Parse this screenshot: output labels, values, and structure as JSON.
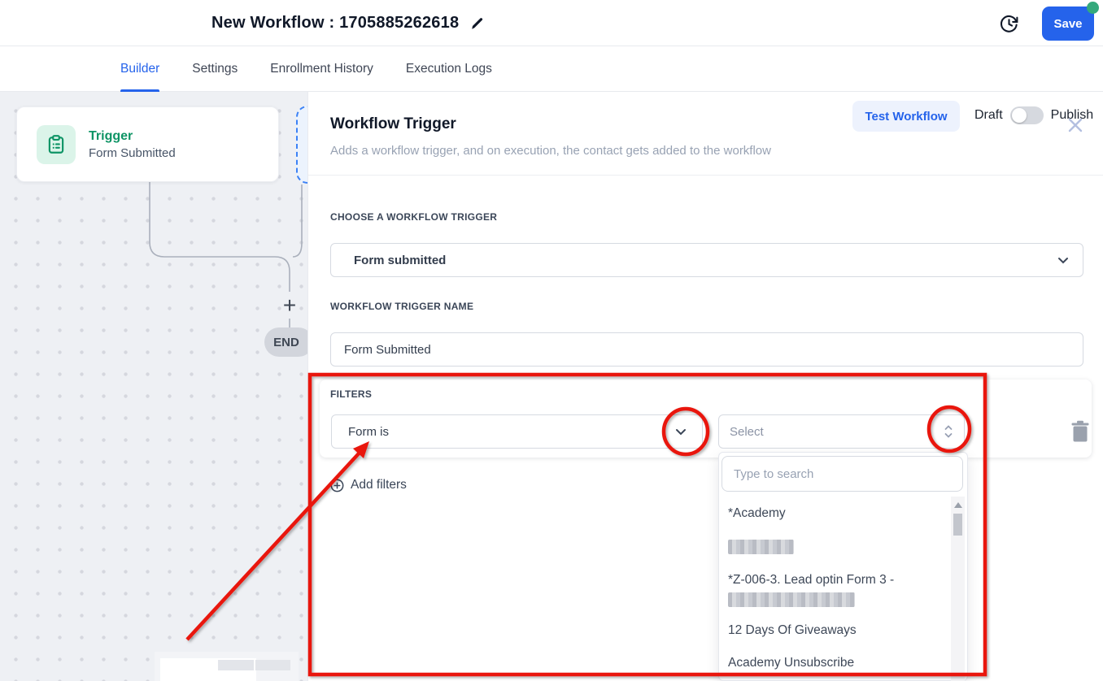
{
  "header": {
    "title": "New Workflow : 1705885262618",
    "save_label": "Save"
  },
  "tabs": {
    "items": [
      {
        "label": "Builder",
        "active": true
      },
      {
        "label": "Settings",
        "active": false
      },
      {
        "label": "Enrollment History",
        "active": false
      },
      {
        "label": "Execution Logs",
        "active": false
      }
    ],
    "test_workflow_label": "Test Workflow",
    "draft_label": "Draft",
    "publish_label": "Publish",
    "toggle_state": "draft"
  },
  "canvas": {
    "trigger_card": {
      "title": "Trigger",
      "subtitle": "Form Submitted"
    },
    "plus_label": "+",
    "end_label": "END"
  },
  "panel": {
    "title": "Workflow Trigger",
    "description": "Adds a workflow trigger, and on execution, the contact gets added to the workflow",
    "trigger_section": {
      "label": "CHOOSE A WORKFLOW TRIGGER",
      "value": "Form submitted"
    },
    "name_section": {
      "label": "WORKFLOW TRIGGER NAME",
      "value": "Form Submitted"
    },
    "filters_section": {
      "label": "FILTERS",
      "field_value": "Form is",
      "value_placeholder": "Select",
      "add_filters_label": "Add filters"
    },
    "dropdown": {
      "search_placeholder": "Type to search",
      "options": [
        {
          "label": "*Academy",
          "redacted": false
        },
        {
          "label": "",
          "redacted": true
        },
        {
          "label": "*Z-006-3. Lead optin Form 3 -",
          "redacted": false,
          "second_line_redacted": true
        },
        {
          "label": "12 Days Of Giveaways",
          "redacted": false
        },
        {
          "label": "Academy Unsubscribe",
          "redacted": false
        }
      ]
    }
  },
  "colors": {
    "accent_blue": "#2563eb",
    "trigger_green": "#0e9465",
    "annotation_red": "#e9150e",
    "save_status_green": "#34a97c"
  }
}
